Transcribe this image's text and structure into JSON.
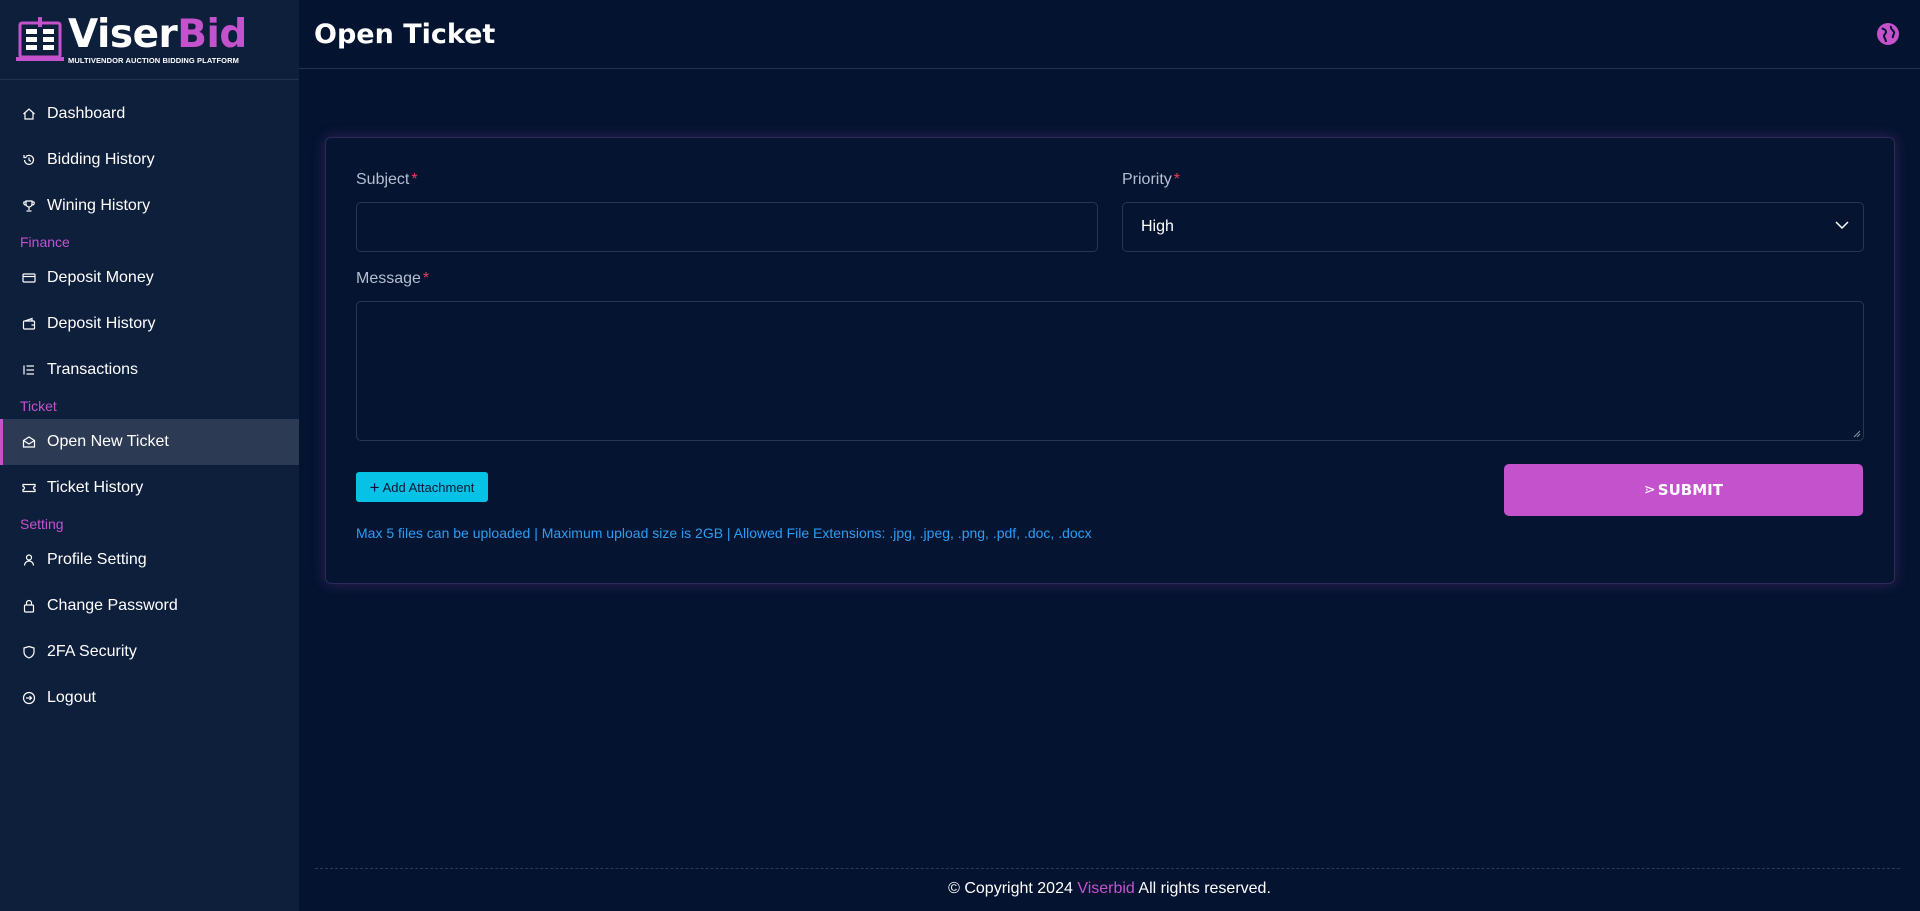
{
  "brand": {
    "word1": "Viser",
    "word2": "Bid",
    "tagline": "MULTIVENDOR AUCTION BIDDING PLATFORM"
  },
  "sidebar": {
    "items": [
      {
        "label": "Dashboard",
        "icon": "home-icon"
      },
      {
        "label": "Bidding History",
        "icon": "history-icon"
      },
      {
        "label": "Wining History",
        "icon": "trophy-icon"
      }
    ],
    "finance_title": "Finance",
    "finance": [
      {
        "label": "Deposit Money",
        "icon": "credit-card-icon"
      },
      {
        "label": "Deposit History",
        "icon": "wallet-icon"
      },
      {
        "label": "Transactions",
        "icon": "list-icon"
      }
    ],
    "ticket_title": "Ticket",
    "ticket": [
      {
        "label": "Open New Ticket",
        "icon": "envelope-open-icon",
        "active": true
      },
      {
        "label": "Ticket History",
        "icon": "ticket-icon"
      }
    ],
    "setting_title": "Setting",
    "setting": [
      {
        "label": "Profile Setting",
        "icon": "user-icon"
      },
      {
        "label": "Change Password",
        "icon": "lock-icon"
      },
      {
        "label": "2FA Security",
        "icon": "shield-icon"
      },
      {
        "label": "Logout",
        "icon": "logout-icon"
      }
    ]
  },
  "header": {
    "title": "Open Ticket",
    "language_icon": "globe-icon"
  },
  "form": {
    "subject_label": "Subject",
    "subject_value": "",
    "priority_label": "Priority",
    "priority_value": "High",
    "message_label": "Message",
    "message_value": "",
    "required_mark": "*",
    "attach_plus": "+",
    "attach_label": "Add Attachment",
    "file_hint": "Max 5 files can be uploaded | Maximum upload size is 2GB | Allowed File Extensions: .jpg, .jpeg, .png, .pdf, .doc, .docx",
    "submit_icon": "⋗",
    "submit_label": "SUBMIT"
  },
  "footer": {
    "prefix": "© Copyright 2024",
    "brand": "Viserbid",
    "suffix": "All rights reserved."
  },
  "colors": {
    "accent": "#c452cc",
    "attach": "#06c2e6",
    "hint": "#2d9cf3",
    "required": "#e7405a",
    "background": "#041330",
    "sidebar": "#0e1f3b"
  }
}
